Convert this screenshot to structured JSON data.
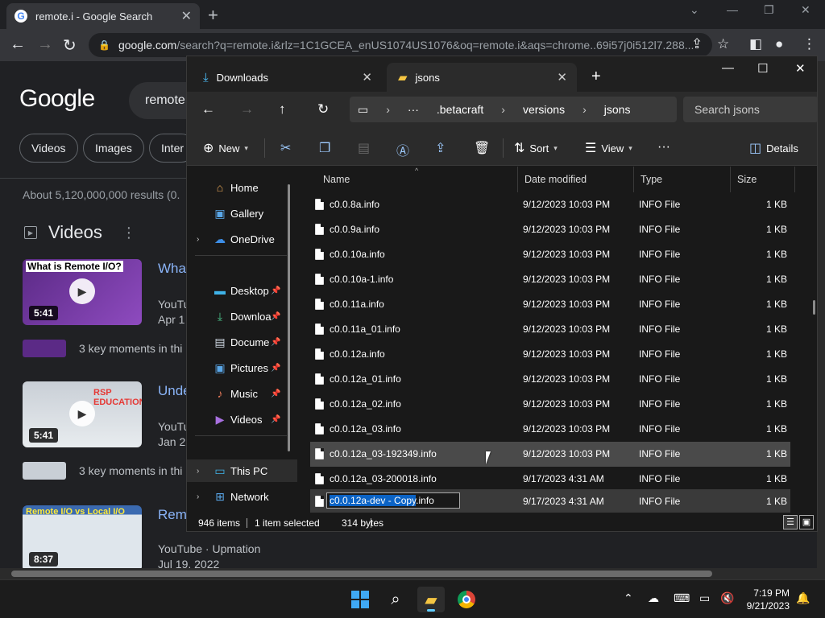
{
  "chrome": {
    "tab_title": "remote.i - Google Search",
    "url_domain": "google.com",
    "url_rest": "/search?q=remote.i&rlz=1C1GCEA_enUS1074US1076&oq=remote.i&aqs=chrome..69i57j0i512l7.288..."
  },
  "google": {
    "logo": "Google",
    "query": "remote",
    "chips": [
      "Videos",
      "Images",
      "Inter"
    ],
    "results_count": "About 5,120,000,000 results (0.",
    "videos_heading": "Videos",
    "videos": [
      {
        "thumb_caption": "What is Remote I/O?",
        "duration": "5:41",
        "title": "What",
        "source": "YouTu",
        "date": "Apr 1",
        "key_moments": "3 key moments in thi"
      },
      {
        "thumb_caption": "RSP EDUCATION",
        "duration": "5:41",
        "title": "Unde",
        "source": "YouTu",
        "date": "Jan 2",
        "key_moments": "3 key moments in thi"
      },
      {
        "thumb_caption": "Remote I/O vs Local I/O",
        "duration": "8:37",
        "title": "Rem",
        "source": "YouTube · Upmation",
        "date": "Jul 19, 2022"
      }
    ]
  },
  "explorer": {
    "tabs": [
      {
        "label": "Downloads"
      },
      {
        "label": "jsons"
      }
    ],
    "breadcrumb": [
      ".betacraft",
      "versions",
      "jsons"
    ],
    "search_placeholder": "Search jsons",
    "commands": {
      "new": "New",
      "sort": "Sort",
      "view": "View",
      "details": "Details"
    },
    "nav": {
      "home": "Home",
      "gallery": "Gallery",
      "onedrive": "OneDrive",
      "desktop": "Desktop",
      "downloads": "Downloa",
      "documents": "Docume",
      "pictures": "Pictures",
      "music": "Music",
      "videos": "Videos",
      "thispc": "This PC",
      "network": "Network"
    },
    "columns": {
      "name": "Name",
      "date": "Date modified",
      "type": "Type",
      "size": "Size"
    },
    "files": [
      {
        "name": "c0.0.8a.info",
        "date": "9/12/2023 10:03 PM",
        "type": "INFO File",
        "size": "1 KB"
      },
      {
        "name": "c0.0.9a.info",
        "date": "9/12/2023 10:03 PM",
        "type": "INFO File",
        "size": "1 KB"
      },
      {
        "name": "c0.0.10a.info",
        "date": "9/12/2023 10:03 PM",
        "type": "INFO File",
        "size": "1 KB"
      },
      {
        "name": "c0.0.10a-1.info",
        "date": "9/12/2023 10:03 PM",
        "type": "INFO File",
        "size": "1 KB"
      },
      {
        "name": "c0.0.11a.info",
        "date": "9/12/2023 10:03 PM",
        "type": "INFO File",
        "size": "1 KB"
      },
      {
        "name": "c0.0.11a_01.info",
        "date": "9/12/2023 10:03 PM",
        "type": "INFO File",
        "size": "1 KB"
      },
      {
        "name": "c0.0.12a.info",
        "date": "9/12/2023 10:03 PM",
        "type": "INFO File",
        "size": "1 KB"
      },
      {
        "name": "c0.0.12a_01.info",
        "date": "9/12/2023 10:03 PM",
        "type": "INFO File",
        "size": "1 KB"
      },
      {
        "name": "c0.0.12a_02.info",
        "date": "9/12/2023 10:03 PM",
        "type": "INFO File",
        "size": "1 KB"
      },
      {
        "name": "c0.0.12a_03.info",
        "date": "9/12/2023 10:03 PM",
        "type": "INFO File",
        "size": "1 KB"
      },
      {
        "name": "c0.0.12a_03-192349.info",
        "date": "9/12/2023 10:03 PM",
        "type": "INFO File",
        "size": "1 KB"
      },
      {
        "name": "c0.0.12a_03-200018.info",
        "date": "9/17/2023 4:31 AM",
        "type": "INFO File",
        "size": "1 KB"
      }
    ],
    "editing_row": {
      "name_selected": "c0.0.12a-dev - Copy",
      "name_ext": ".info",
      "date": "9/17/2023 4:31 AM",
      "type": "INFO File",
      "size": "1 KB"
    },
    "status": {
      "items": "946 items",
      "selected": "1 item selected",
      "bytes": "314 bytes"
    }
  },
  "taskbar": {
    "time": "7:19 PM",
    "date": "9/21/2023"
  }
}
